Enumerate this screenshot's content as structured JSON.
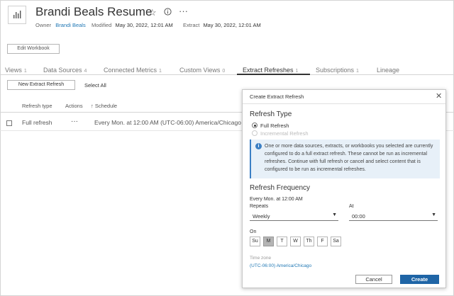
{
  "header": {
    "title": "Brandi Beals Resume",
    "star_icon": "star-icon",
    "info_icon": "info-icon",
    "more_icon": "more-icon",
    "owner_label": "Owner",
    "owner_value": "Brandi Beals",
    "modified_label": "Modified",
    "modified_value": "May 30, 2022, 12:01 AM",
    "extract_label": "Extract",
    "extract_value": "May 30, 2022, 12:01 AM",
    "edit_workbook": "Edit Workbook"
  },
  "tabs": [
    {
      "label": "Views",
      "count": "1"
    },
    {
      "label": "Data Sources",
      "count": "4"
    },
    {
      "label": "Connected Metrics",
      "count": "1"
    },
    {
      "label": "Custom Views",
      "count": "0"
    },
    {
      "label": "Extract Refreshes",
      "count": "1"
    },
    {
      "label": "Subscriptions",
      "count": "1"
    },
    {
      "label": "Lineage",
      "count": ""
    }
  ],
  "toolbar": {
    "new_refresh": "New Extract Refresh",
    "select_all": "Select All"
  },
  "table": {
    "headers": [
      "Refresh type",
      "Actions",
      "↑ Schedule"
    ],
    "rows": [
      {
        "type": "Full refresh",
        "actions": "···",
        "schedule": "Every Mon. at 12:00 AM (UTC-06:00) America/Chicago"
      }
    ]
  },
  "dialog": {
    "title": "Create Extract Refresh",
    "close": "✕",
    "refresh_type_heading": "Refresh Type",
    "full_refresh": "Full Refresh",
    "incremental_refresh": "Incremental Refresh",
    "info_text": "One or more data sources, extracts, or workbooks you selected are currently configured to do a full extract refresh. These cannot be run as incremental refreshes. Continue with full refresh or cancel and select content that is configured to be run as incremental refreshes.",
    "frequency_heading": "Refresh Frequency",
    "frequency_summary": "Every Mon. at 12:00 AM",
    "repeats_label": "Repeats",
    "repeats_value": "Weekly",
    "at_label": "At",
    "at_value": "00:00",
    "on_label": "On",
    "days": [
      {
        "label": "Su",
        "selected": false
      },
      {
        "label": "M",
        "selected": true
      },
      {
        "label": "T",
        "selected": false
      },
      {
        "label": "W",
        "selected": false
      },
      {
        "label": "Th",
        "selected": false
      },
      {
        "label": "F",
        "selected": false
      },
      {
        "label": "Sa",
        "selected": false
      }
    ],
    "timezone_label": "Time zone",
    "timezone_value": "(UTC-06:00) America/Chicago",
    "cancel": "Cancel",
    "create": "Create",
    "accent_color": "#1f65a6"
  }
}
